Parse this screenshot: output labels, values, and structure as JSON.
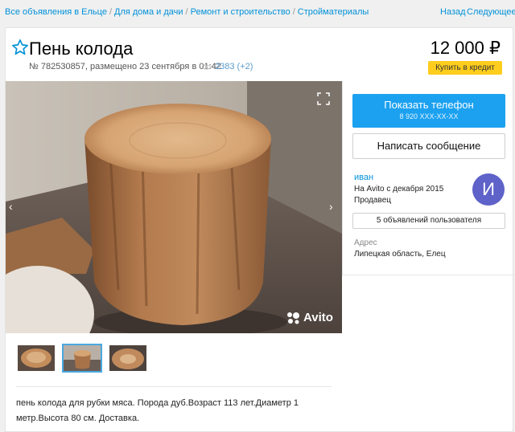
{
  "breadcrumbs": {
    "items": [
      "Все объявления в Ельце",
      "Для дома и дачи",
      "Ремонт и строительство",
      "Стройматериалы"
    ],
    "separator": "/"
  },
  "nav": {
    "back": "Назад",
    "next": "Следующее",
    "next_icon": "chevron-right-icon"
  },
  "listing": {
    "title": "Пень колода",
    "meta": "№ 782530857, размещено 23 сентября в 01:42",
    "views": "2383 (+2)",
    "price": "12 000 ₽",
    "credit_label": "Купить в кредит",
    "description": "пень колода для рубки мяса. Порода дуб.Возраст 113 лет.Диаметр 1 метр.Высота 80 см. Доставка."
  },
  "gallery": {
    "watermark": "Avito",
    "thumb_count": 3,
    "active_thumb": 2
  },
  "contact": {
    "show_phone": "Показать телефон",
    "phone_masked": "8 920 XXX-XX-XX",
    "write_message": "Написать сообщение"
  },
  "seller": {
    "name": "иван",
    "since": "На Avito с декабря 2015",
    "role": "Продавец",
    "avatar_letter": "И",
    "ads_button": "5 объявлений пользователя",
    "address_label": "Адрес",
    "address": "Липецкая область, Елец"
  },
  "colors": {
    "link": "#0091d9",
    "primary": "#1ca1f0",
    "credit": "#ffcd1e",
    "avatar": "#5e62c9",
    "thumb_active": "#4aa8e0"
  }
}
